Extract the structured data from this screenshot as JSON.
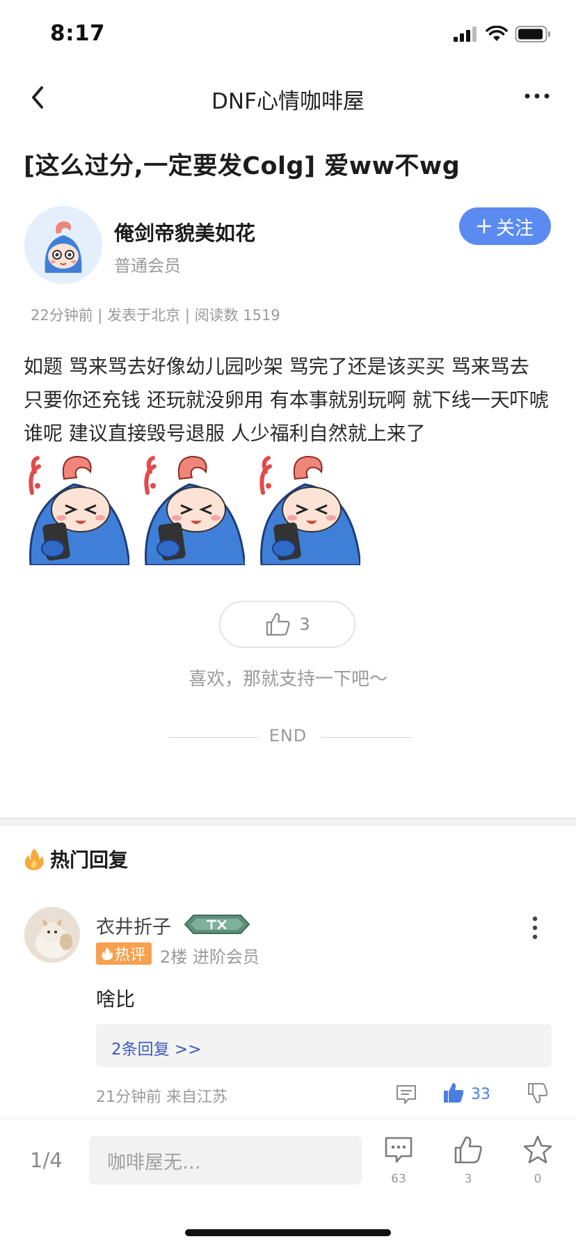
{
  "status": {
    "time": "8:17"
  },
  "nav": {
    "title": "DNF心情咖啡屋"
  },
  "post": {
    "title": "[这么过分,一定要发Colg] 爱ww不wg",
    "author": {
      "name": "俺剑帝貌美如花",
      "level": "普通会员"
    },
    "follow_label": "关注",
    "meta": "22分钟前 | 发表于北京 | 阅读数 1519",
    "content": "如题 骂来骂去好像幼儿园吵架 骂完了还是该买买 骂来骂去 只要你还充钱 还玩就没卵用 有本事就别玩啊  就下线一天吓唬谁呢 建议直接毁号退服 人少福利自然就上来了",
    "likes": "3",
    "like_tip": "喜欢，那就支持一下吧～",
    "end_text": "END"
  },
  "hot_replies": {
    "heading": "热门回复",
    "items": [
      {
        "user": "衣井折子",
        "tag": "热评",
        "floor_info": "2楼  进阶会员",
        "text": "啥比",
        "replies_link": "2条回复 >>",
        "time_location": "21分钟前  来自江苏",
        "likes": "33"
      }
    ]
  },
  "bottom": {
    "page": "1/4",
    "input_placeholder": "咖啡屋无…",
    "comments": "63",
    "likes": "3",
    "favorites": "0"
  },
  "icons": {
    "back": "chevron-left-icon",
    "more": "more-horizontal-icon",
    "fire": "fire-icon",
    "comment": "comment-icon",
    "like": "thumbs-up-icon",
    "dislike": "thumbs-down-icon",
    "star": "star-icon"
  },
  "colors": {
    "accent": "#5b8bf0",
    "hot_tag": "#f7a04d",
    "link": "#3b5bbf"
  }
}
